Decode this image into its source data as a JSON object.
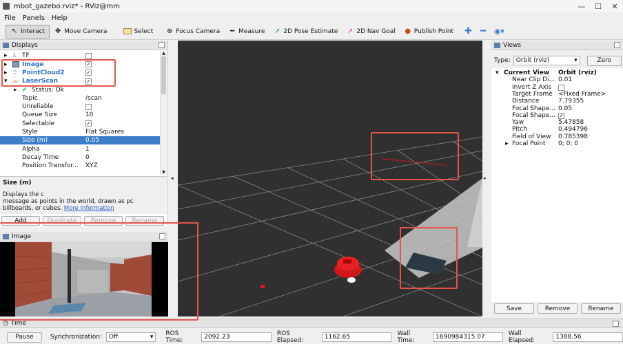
{
  "window": {
    "title": "mbot_gazebo.rviz* - RViz@mm",
    "minimize": "—",
    "maximize": "☐",
    "close": "✕"
  },
  "menu": [
    "File",
    "Panels",
    "Help"
  ],
  "toolbar": [
    {
      "label": "Interact",
      "icon": "cursor-icon",
      "glyph": "↖"
    },
    {
      "label": "Move Camera",
      "icon": "move-icon",
      "glyph": "✥"
    },
    {
      "label": "Select",
      "icon": "select-icon",
      "glyph": "▭"
    },
    {
      "label": "Focus Camera",
      "icon": "target-icon",
      "glyph": "⊕"
    },
    {
      "label": "Measure",
      "icon": "ruler-icon",
      "glyph": "━"
    },
    {
      "label": "2D Pose Estimate",
      "icon": "green-arrow-icon",
      "glyph": "➚"
    },
    {
      "label": "2D Nav Goal",
      "icon": "pink-arrow-icon",
      "glyph": "➚"
    },
    {
      "label": "Publish Point",
      "icon": "pin-icon",
      "glyph": "⬤"
    }
  ],
  "displays": {
    "title": "Displays",
    "rows": [
      {
        "name": "TF",
        "type": "plain",
        "arrow": "▸",
        "checked": false
      },
      {
        "name": "Image",
        "type": "display",
        "arrow": "▸",
        "checked": true
      },
      {
        "name": "PointCloud2",
        "type": "display",
        "arrow": "▸",
        "checked": true
      },
      {
        "name": "LaserScan",
        "type": "display",
        "arrow": "▾",
        "checked": true
      },
      {
        "name": "Status: Ok",
        "type": "status"
      },
      {
        "name": "Topic",
        "value": "/scan"
      },
      {
        "name": "Unreliable",
        "value": "",
        "check": false
      },
      {
        "name": "Queue Size",
        "value": "10"
      },
      {
        "name": "Selectable",
        "value": "",
        "check": true
      },
      {
        "name": "Style",
        "value": "Flat Squares"
      },
      {
        "name": "Size (m)",
        "value": "0.05",
        "selected": true
      },
      {
        "name": "Alpha",
        "value": "1"
      },
      {
        "name": "Decay Time",
        "value": "0"
      },
      {
        "name": "Position Transfor...",
        "value": "XYZ"
      }
    ],
    "desc_title": "Size (m)",
    "desc_text_a": "Displays the c",
    "desc_text_b": "message as points in the world, drawn as pc billboards, or cubes.",
    "desc_link": "More Information",
    "buttons": [
      "Add",
      "Duplicate",
      "Remove",
      "Rename"
    ]
  },
  "image_panel": {
    "title": "Image"
  },
  "views": {
    "title": "Views",
    "type_label": "Type:",
    "type_value": "Orbit (rviz)",
    "zero": "Zero",
    "header_k": "Current View",
    "header_v": "Orbit (rviz)",
    "rows": [
      {
        "k": "Near Clip Di...",
        "v": "0.01"
      },
      {
        "k": "Invert Z Axis",
        "v": "",
        "check": false
      },
      {
        "k": "Target Frame",
        "v": "<Fixed Frame>"
      },
      {
        "k": "Distance",
        "v": "7.79355"
      },
      {
        "k": "Focal Shape...",
        "v": "0.05"
      },
      {
        "k": "Focal Shape...",
        "v": "",
        "check": true
      },
      {
        "k": "Yaw",
        "v": "5.47858"
      },
      {
        "k": "Pitch",
        "v": "0.494796"
      },
      {
        "k": "Field of View",
        "v": "0.785398"
      },
      {
        "k": "Focal Point",
        "v": "0; 0; 0",
        "arrow": "▸"
      }
    ],
    "buttons": [
      "Save",
      "Remove",
      "Rename"
    ]
  },
  "time": {
    "title": "Time",
    "pause": "Pause",
    "sync_label": "Synchronization:",
    "sync_value": "Off",
    "ros_time_label": "ROS Time:",
    "ros_time": "2092.23",
    "ros_elapsed_label": "ROS Elapsed:",
    "ros_elapsed": "1162.65",
    "wall_time_label": "Wall Time:",
    "wall_time": "1690984315.07",
    "wall_elapsed_label": "Wall Elapsed:",
    "wall_elapsed": "1388.56"
  },
  "colors": {
    "accent": "#3d7dc8",
    "highlight": "#e8534a",
    "viewport": "#2f2f2f",
    "grid": "#8a8a8a",
    "robot": "#d01818"
  }
}
